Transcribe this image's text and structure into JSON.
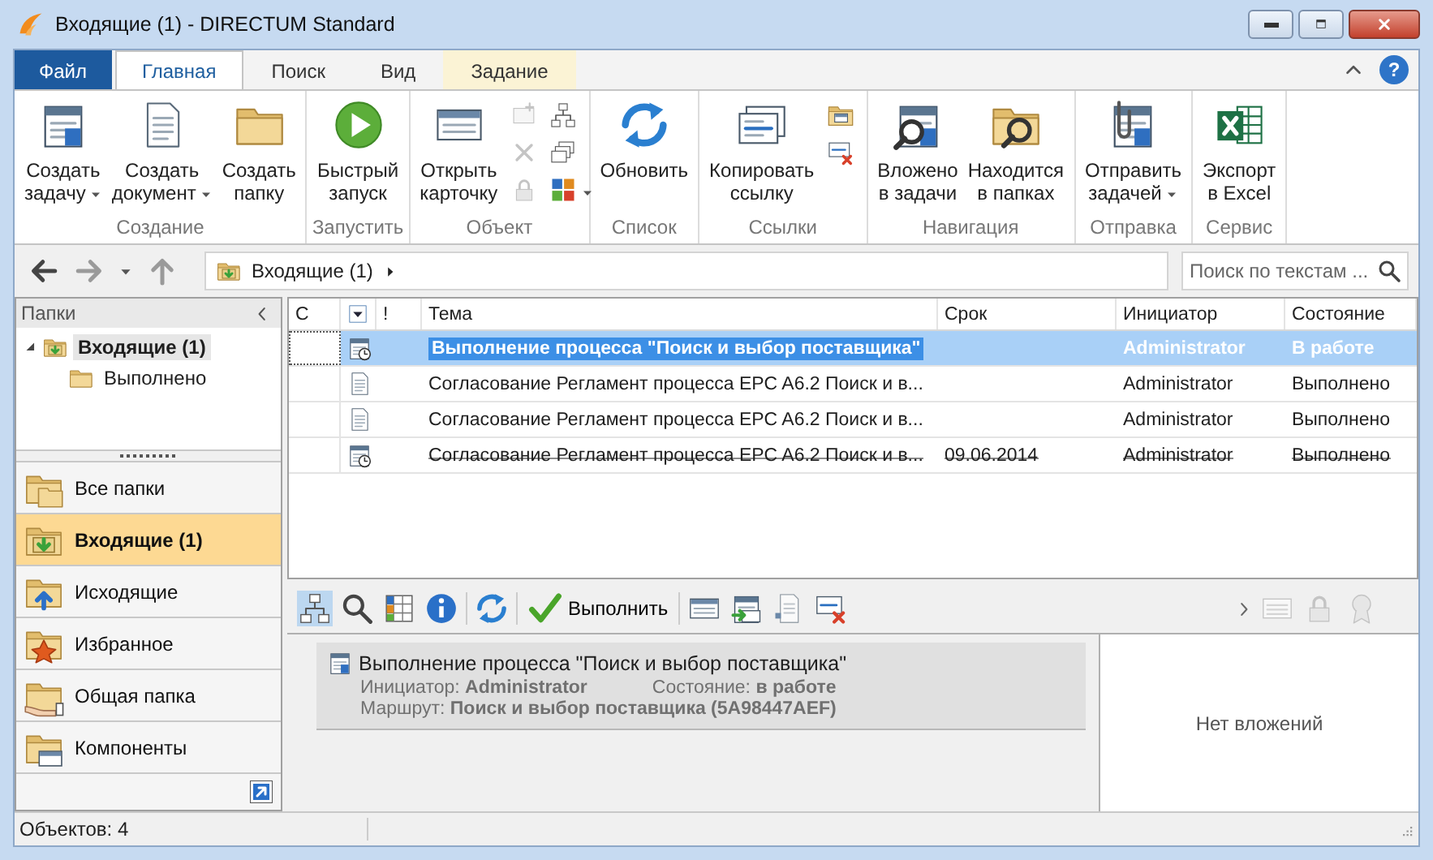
{
  "window": {
    "title": "Входящие (1) - DIRECTUM Standard"
  },
  "ribbon": {
    "tabs": [
      {
        "label": "Файл",
        "kind": "file",
        "selected": false
      },
      {
        "label": "Главная",
        "kind": "tab",
        "selected": true
      },
      {
        "label": "Поиск",
        "kind": "tab",
        "selected": false
      },
      {
        "label": "Вид",
        "kind": "tab",
        "selected": false
      },
      {
        "label": "Задание",
        "kind": "context",
        "selected": false
      }
    ],
    "help": "?",
    "groups": [
      {
        "label": "Создание",
        "buttons": [
          {
            "lines": [
              "Создать",
              "задачу"
            ],
            "dropdown": true
          },
          {
            "lines": [
              "Создать",
              "документ"
            ],
            "dropdown": true
          },
          {
            "lines": [
              "Создать",
              "папку"
            ],
            "dropdown": false
          }
        ]
      },
      {
        "label": "Запустить",
        "buttons": [
          {
            "lines": [
              "Быстрый",
              "запуск"
            ],
            "dropdown": false
          }
        ]
      },
      {
        "label": "Объект",
        "buttons": [
          {
            "lines": [
              "Открыть",
              "карточку"
            ],
            "dropdown": false
          }
        ]
      },
      {
        "label": "Список",
        "buttons": [
          {
            "lines": [
              "Обновить"
            ],
            "dropdown": false
          }
        ]
      },
      {
        "label": "Ссылки",
        "buttons": [
          {
            "lines": [
              "Копировать",
              "ссылку"
            ],
            "dropdown": false
          }
        ]
      },
      {
        "label": "Навигация",
        "buttons": [
          {
            "lines": [
              "Вложено",
              "в задачи"
            ],
            "dropdown": false
          },
          {
            "lines": [
              "Находится",
              "в папках"
            ],
            "dropdown": false
          }
        ]
      },
      {
        "label": "Отправка",
        "buttons": [
          {
            "lines": [
              "Отправить",
              "задачей"
            ],
            "dropdown": true
          }
        ]
      },
      {
        "label": "Сервис",
        "buttons": [
          {
            "lines": [
              "Экспорт",
              "в Excel"
            ],
            "dropdown": false
          }
        ]
      }
    ]
  },
  "navigation": {
    "breadcrumb": "Входящие (1)",
    "search": {
      "placeholder": "Поиск по текстам ..."
    }
  },
  "folders": {
    "title": "Папки",
    "tree": [
      {
        "label": "Входящие (1)",
        "selected": true,
        "expanded": true,
        "children": [
          {
            "label": "Выполнено",
            "selected": false
          }
        ]
      }
    ],
    "items": [
      {
        "label": "Все папки",
        "selected": false
      },
      {
        "label": "Входящие (1)",
        "selected": true
      },
      {
        "label": "Исходящие",
        "selected": false
      },
      {
        "label": "Избранное",
        "selected": false
      },
      {
        "label": "Общая папка",
        "selected": false
      },
      {
        "label": "Компоненты",
        "selected": false
      }
    ]
  },
  "table": {
    "columns": [
      "С",
      "!",
      "Тема",
      "Срок",
      "Инициатор",
      "Состояние"
    ],
    "rows": [
      {
        "kind": "task",
        "subject": "Выполнение процесса \"Поиск и выбор поставщика\"",
        "initiator": "Administrator",
        "state": "В работе",
        "selected": true,
        "unread": true,
        "struck": false
      },
      {
        "kind": "document",
        "subject": "Согласование Регламент процесса EPC A6.2 Поиск и в...",
        "initiator": "Administrator",
        "state": "Выполнено",
        "selected": false,
        "unread": false,
        "struck": false
      },
      {
        "kind": "document",
        "subject": "Согласование Регламент процесса EPC A6.2 Поиск и в...",
        "initiator": "Administrator",
        "state": "Выполнено",
        "selected": false,
        "unread": false,
        "struck": false
      },
      {
        "kind": "task",
        "subject": "Согласование Регламент процесса EPC A6.2 Поиск и в...",
        "due": "09.06.2014",
        "initiator": "Administrator",
        "state": "Выполнено",
        "selected": false,
        "unread": false,
        "struck": true
      }
    ]
  },
  "preview": {
    "toolbar": {
      "execute": "Выполнить"
    },
    "title": "Выполнение процесса \"Поиск и выбор поставщика\"",
    "info": [
      "Инициатор: **Administrator**",
      "Состояние: **в работе**"
    ],
    "route": "Маршрут: **Поиск и выбор поставщика (5A98447AEF)**",
    "attachments": "Нет вложений"
  },
  "status_bar": {
    "objects": "Объектов: 4"
  }
}
